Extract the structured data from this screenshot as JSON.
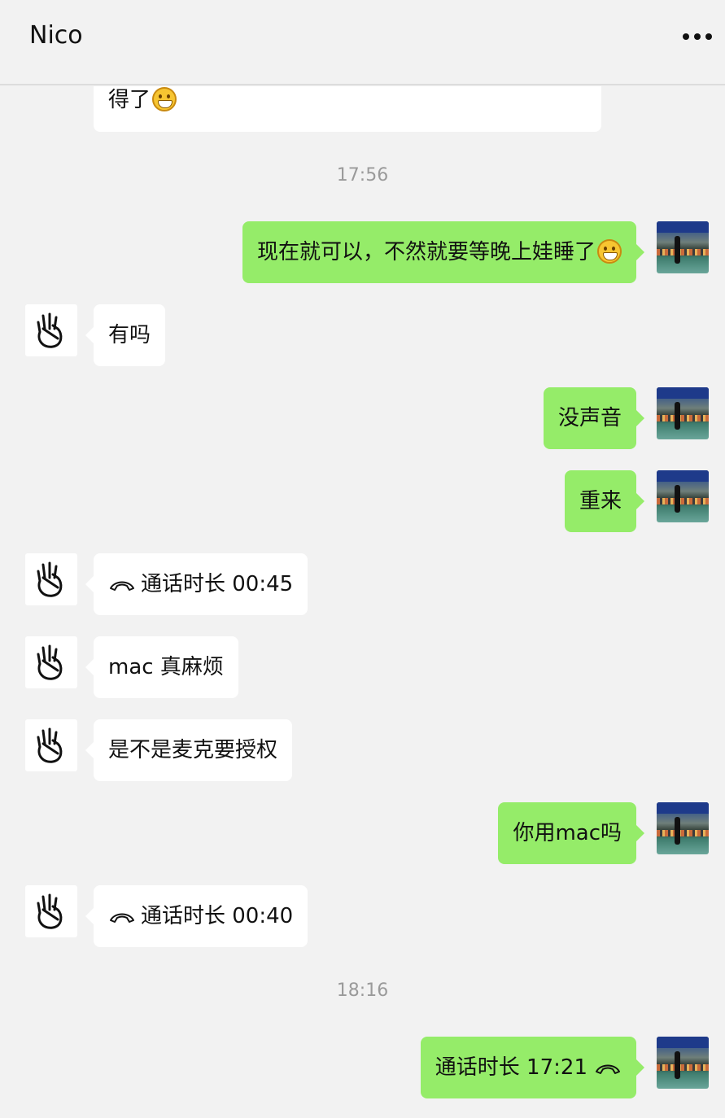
{
  "header": {
    "title": "Nico",
    "more_icon": "more-icon"
  },
  "times": [
    "17:56",
    "18:16"
  ],
  "messages": [
    {
      "side": "in",
      "text": "得了",
      "emoji": "grin-emoji"
    },
    {
      "side": "out",
      "text": "现在就可以，不然就要等晚上娃睡了",
      "emoji": "grin-emoji"
    },
    {
      "side": "in",
      "text": "有吗"
    },
    {
      "side": "out",
      "text": "没声音"
    },
    {
      "side": "out",
      "text": "重来"
    },
    {
      "side": "in",
      "text": "通话时长 00:45",
      "icon": "phone-hangup-icon"
    },
    {
      "side": "in",
      "text": "mac 真麻烦"
    },
    {
      "side": "in",
      "text": "是不是麦克要授权"
    },
    {
      "side": "out",
      "text": "你用mac吗"
    },
    {
      "side": "in",
      "text": "通话时长 00:40",
      "icon": "phone-hangup-icon"
    },
    {
      "side": "out",
      "text": "通话时长 17:21",
      "icon": "phone-hangup-icon"
    }
  ],
  "colors": {
    "outgoing": "#95ec69",
    "incoming": "#ffffff",
    "background": "#f2f2f2"
  }
}
